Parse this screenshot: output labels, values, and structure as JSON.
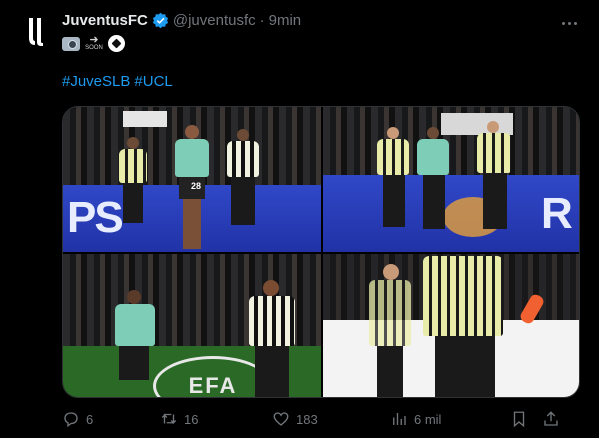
{
  "account": {
    "display_name": "JuventusFC",
    "handle": "@juventusfc",
    "separator": "·",
    "time": "9min"
  },
  "tweet": {
    "emoji": [
      "camera-flash-emoji",
      "soon-arrow-emoji",
      "soccer-ball-emoji"
    ],
    "soon_text": "SOON",
    "hashtags": [
      "#JuveSLB",
      "#UCL"
    ]
  },
  "media": {
    "player_number": "28",
    "ad_text": "PS",
    "ad_text_2": "R",
    "uefa_text": "EFA"
  },
  "actions": {
    "replies": "6",
    "retweets": "16",
    "likes": "183",
    "views": "6 mil"
  },
  "colors": {
    "background": "#000000",
    "link": "#1d9bf0",
    "muted": "#71767b",
    "verified": "#1d9bf0"
  }
}
